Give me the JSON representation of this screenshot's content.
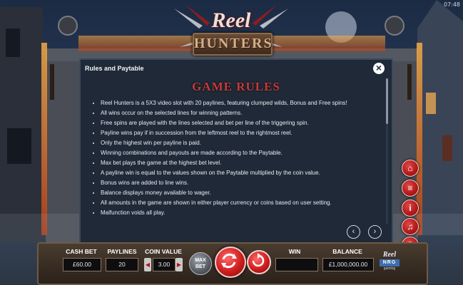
{
  "status": {
    "time": "07:48"
  },
  "logo": {
    "line1": "Reel",
    "line2": "HUNTERS"
  },
  "panel": {
    "title": "Rules and Paytable",
    "heading": "GAME RULES",
    "rules": [
      "Reel Hunters is a 5X3 video slot with 20 paylines, featuring clumped wilds, Bonus and Free spins!",
      "All wins occur on the selected lines for winning patterns.",
      "Free spins are played with the lines selected and bet per line of the triggering spin.",
      "Payline wins pay if in succession from the leftmost reel to the rightmost reel.",
      "Only the highest win per payline is paid.",
      "Winning combinations and payouts are made according to the Paytable.",
      "Max bet plays the game at the highest bet level.",
      "A payline win is equal to the values shown on the Paytable multiplied by the coin value.",
      "Bonus wins are added to line wins.",
      "Balance displays money available to wager.",
      "All amounts in the game are shown in either player currency or coins based on user setting.",
      "Malfunction voids all play."
    ],
    "close_icon": "close-icon",
    "prev_icon": "chevron-left-icon",
    "next_icon": "chevron-right-icon"
  },
  "side_menu": [
    {
      "name": "home-icon",
      "glyph": "⌂"
    },
    {
      "name": "menu-icon",
      "glyph": "≡"
    },
    {
      "name": "info-icon",
      "glyph": "i"
    },
    {
      "name": "sound-icon",
      "glyph": "♫"
    },
    {
      "name": "settings-icon",
      "glyph": "⚙"
    },
    {
      "name": "close-icon",
      "glyph": "✕"
    }
  ],
  "bottom": {
    "cash_bet_label": "CASH BET",
    "cash_bet_value": "£60.00",
    "paylines_label": "PAYLINES",
    "paylines_value": "20",
    "coin_value_label": "COIN VALUE",
    "coin_value": "3.00",
    "max_bet_line1": "MAX",
    "max_bet_line2": "BET",
    "win_label": "WIN",
    "win_value": "",
    "balance_label": "BALANCE",
    "balance_value": "£1,000,000.00",
    "brand_top": "Reel",
    "brand_mid": "NRG",
    "brand_bot": "gaming"
  },
  "colors": {
    "panel_bg": "#1f2937",
    "heading_red": "#c93a3a",
    "button_red": "#cf1d1d"
  }
}
